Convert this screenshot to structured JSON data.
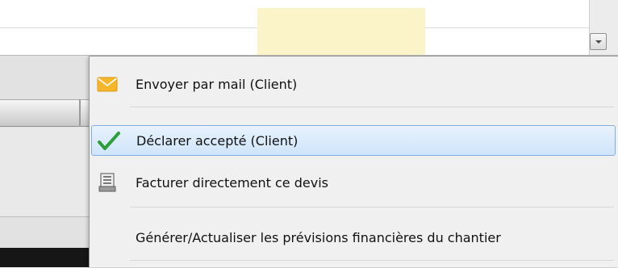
{
  "context_menu": {
    "items": [
      {
        "label": "Envoyer par mail (Client)",
        "icon": "envelope-icon"
      },
      {
        "label": "Déclarer accepté (Client)",
        "icon": "checkmark-icon",
        "highlighted": true
      },
      {
        "label": "Facturer directement ce devis",
        "icon": "document-icon"
      },
      {
        "label": "Générer/Actualiser les prévisions financières du chantier",
        "icon": null
      }
    ]
  },
  "colors": {
    "highlight_border": "#84acdd",
    "highlight_fill": "#cfe5fb",
    "envelope": "#f5b62b",
    "checkmark": "#2e9e3a",
    "yellow_cell": "#fbf4c9"
  }
}
